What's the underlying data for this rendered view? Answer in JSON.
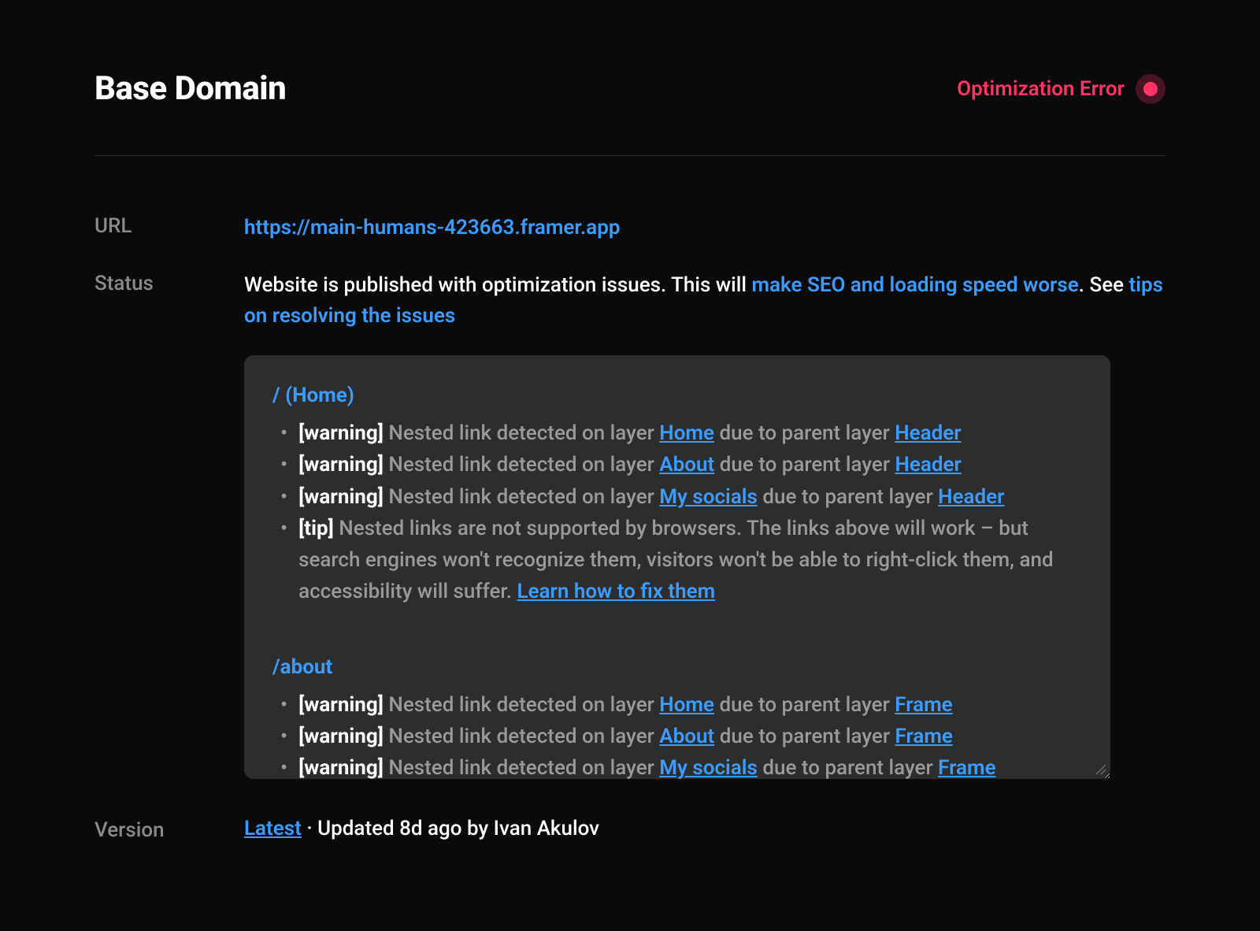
{
  "header": {
    "title": "Base Domain",
    "status_badge": "Optimization Error"
  },
  "fields": {
    "url_label": "URL",
    "url_value": "https://main-humans-423663.framer.app",
    "status_label": "Status",
    "status_text_1": "Website is published with optimization issues. This will ",
    "status_link_1": "make SEO and loading speed worse",
    "status_text_2": ". See ",
    "status_link_2": "tips on resolving the issues",
    "version_label": "Version",
    "version_link": "Latest",
    "version_sep": " · ",
    "version_text": "Updated 8d ago by Ivan Akulov"
  },
  "issues": {
    "pages": [
      {
        "heading": "/ (Home)",
        "items": [
          {
            "kind": "warning",
            "tag": "[warning]",
            "pre": " Nested link detected on layer ",
            "layer": "Home",
            "mid": " due to parent layer ",
            "parent": "Header"
          },
          {
            "kind": "warning",
            "tag": "[warning]",
            "pre": " Nested link detected on layer ",
            "layer": "About",
            "mid": " due to parent layer ",
            "parent": "Header"
          },
          {
            "kind": "warning",
            "tag": "[warning]",
            "pre": " Nested link detected on layer ",
            "layer": "My socials",
            "mid": " due to parent layer ",
            "parent": "Header"
          },
          {
            "kind": "tip",
            "tag": "[tip]",
            "tip_text": " Nested links are not supported by browsers. The links above will work – but search engines won't recognize them, visitors won't be able to right-click them, and accessibility will suffer. ",
            "tip_link": "Learn how to fix them"
          }
        ]
      },
      {
        "heading": "/about",
        "items": [
          {
            "kind": "warning",
            "tag": "[warning]",
            "pre": " Nested link detected on layer ",
            "layer": "Home",
            "mid": " due to parent layer ",
            "parent": "Frame"
          },
          {
            "kind": "warning",
            "tag": "[warning]",
            "pre": " Nested link detected on layer ",
            "layer": "About",
            "mid": " due to parent layer ",
            "parent": "Frame"
          },
          {
            "kind": "warning",
            "tag": "[warning]",
            "pre": " Nested link detected on layer ",
            "layer": "My socials",
            "mid": " due to parent layer ",
            "parent": "Frame"
          }
        ]
      }
    ]
  }
}
